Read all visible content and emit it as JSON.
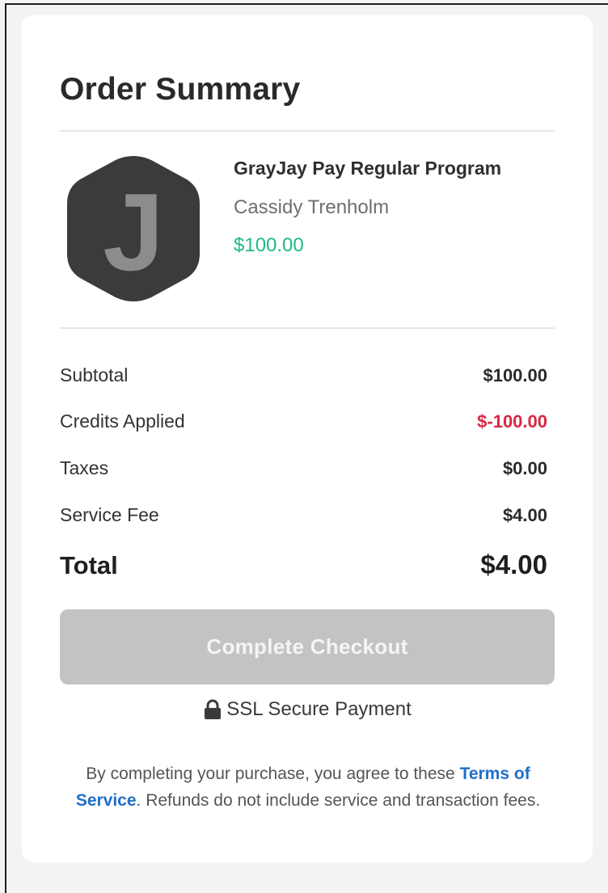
{
  "order_summary": {
    "title": "Order Summary",
    "product": {
      "logo_letter": "J",
      "name": "GrayJay Pay Regular Program",
      "seller": "Cassidy Trenholm",
      "price": "$100.00"
    },
    "lines": [
      {
        "label": "Subtotal",
        "value": "$100.00"
      },
      {
        "label": "Credits Applied",
        "value": "$-100.00"
      },
      {
        "label": "Taxes",
        "value": "$0.00"
      },
      {
        "label": "Service Fee",
        "value": "$4.00"
      }
    ],
    "total": {
      "label": "Total",
      "value": "$4.00"
    },
    "checkout_label": "Complete Checkout",
    "secure_label": "SSL Secure Payment",
    "legal": {
      "prefix": "By completing your purchase, you agree to these ",
      "link": "Terms of Service",
      "suffix": ". Refunds do not include service and transaction fees."
    }
  },
  "colors": {
    "price_green": "#1eb88a",
    "credit_red": "#d92742",
    "link_blue": "#1f6fc9",
    "button_disabled": "#c3c3c5",
    "logo_dark": "#3b3b3b",
    "logo_letter": "#8c8c8c"
  },
  "icons": {
    "lock": "lock-icon"
  }
}
